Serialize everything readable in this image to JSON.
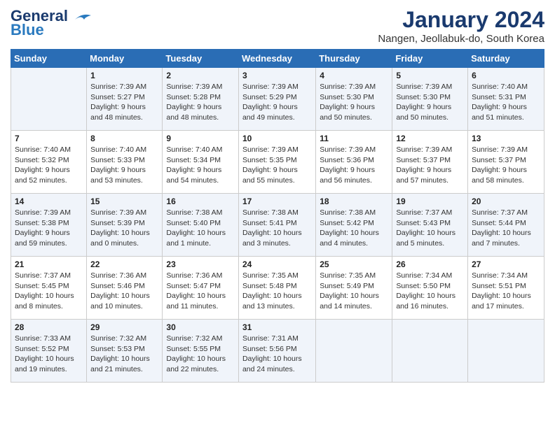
{
  "logo": {
    "line1": "General",
    "line2": "Blue"
  },
  "title": "January 2024",
  "subtitle": "Nangen, Jeollabuk-do, South Korea",
  "days_of_week": [
    "Sunday",
    "Monday",
    "Tuesday",
    "Wednesday",
    "Thursday",
    "Friday",
    "Saturday"
  ],
  "weeks": [
    [
      {
        "day": "",
        "data": ""
      },
      {
        "day": "1",
        "data": "Sunrise: 7:39 AM\nSunset: 5:27 PM\nDaylight: 9 hours\nand 48 minutes."
      },
      {
        "day": "2",
        "data": "Sunrise: 7:39 AM\nSunset: 5:28 PM\nDaylight: 9 hours\nand 48 minutes."
      },
      {
        "day": "3",
        "data": "Sunrise: 7:39 AM\nSunset: 5:29 PM\nDaylight: 9 hours\nand 49 minutes."
      },
      {
        "day": "4",
        "data": "Sunrise: 7:39 AM\nSunset: 5:30 PM\nDaylight: 9 hours\nand 50 minutes."
      },
      {
        "day": "5",
        "data": "Sunrise: 7:39 AM\nSunset: 5:30 PM\nDaylight: 9 hours\nand 50 minutes."
      },
      {
        "day": "6",
        "data": "Sunrise: 7:40 AM\nSunset: 5:31 PM\nDaylight: 9 hours\nand 51 minutes."
      }
    ],
    [
      {
        "day": "7",
        "data": "Sunrise: 7:40 AM\nSunset: 5:32 PM\nDaylight: 9 hours\nand 52 minutes."
      },
      {
        "day": "8",
        "data": "Sunrise: 7:40 AM\nSunset: 5:33 PM\nDaylight: 9 hours\nand 53 minutes."
      },
      {
        "day": "9",
        "data": "Sunrise: 7:40 AM\nSunset: 5:34 PM\nDaylight: 9 hours\nand 54 minutes."
      },
      {
        "day": "10",
        "data": "Sunrise: 7:39 AM\nSunset: 5:35 PM\nDaylight: 9 hours\nand 55 minutes."
      },
      {
        "day": "11",
        "data": "Sunrise: 7:39 AM\nSunset: 5:36 PM\nDaylight: 9 hours\nand 56 minutes."
      },
      {
        "day": "12",
        "data": "Sunrise: 7:39 AM\nSunset: 5:37 PM\nDaylight: 9 hours\nand 57 minutes."
      },
      {
        "day": "13",
        "data": "Sunrise: 7:39 AM\nSunset: 5:37 PM\nDaylight: 9 hours\nand 58 minutes."
      }
    ],
    [
      {
        "day": "14",
        "data": "Sunrise: 7:39 AM\nSunset: 5:38 PM\nDaylight: 9 hours\nand 59 minutes."
      },
      {
        "day": "15",
        "data": "Sunrise: 7:39 AM\nSunset: 5:39 PM\nDaylight: 10 hours\nand 0 minutes."
      },
      {
        "day": "16",
        "data": "Sunrise: 7:38 AM\nSunset: 5:40 PM\nDaylight: 10 hours\nand 1 minute."
      },
      {
        "day": "17",
        "data": "Sunrise: 7:38 AM\nSunset: 5:41 PM\nDaylight: 10 hours\nand 3 minutes."
      },
      {
        "day": "18",
        "data": "Sunrise: 7:38 AM\nSunset: 5:42 PM\nDaylight: 10 hours\nand 4 minutes."
      },
      {
        "day": "19",
        "data": "Sunrise: 7:37 AM\nSunset: 5:43 PM\nDaylight: 10 hours\nand 5 minutes."
      },
      {
        "day": "20",
        "data": "Sunrise: 7:37 AM\nSunset: 5:44 PM\nDaylight: 10 hours\nand 7 minutes."
      }
    ],
    [
      {
        "day": "21",
        "data": "Sunrise: 7:37 AM\nSunset: 5:45 PM\nDaylight: 10 hours\nand 8 minutes."
      },
      {
        "day": "22",
        "data": "Sunrise: 7:36 AM\nSunset: 5:46 PM\nDaylight: 10 hours\nand 10 minutes."
      },
      {
        "day": "23",
        "data": "Sunrise: 7:36 AM\nSunset: 5:47 PM\nDaylight: 10 hours\nand 11 minutes."
      },
      {
        "day": "24",
        "data": "Sunrise: 7:35 AM\nSunset: 5:48 PM\nDaylight: 10 hours\nand 13 minutes."
      },
      {
        "day": "25",
        "data": "Sunrise: 7:35 AM\nSunset: 5:49 PM\nDaylight: 10 hours\nand 14 minutes."
      },
      {
        "day": "26",
        "data": "Sunrise: 7:34 AM\nSunset: 5:50 PM\nDaylight: 10 hours\nand 16 minutes."
      },
      {
        "day": "27",
        "data": "Sunrise: 7:34 AM\nSunset: 5:51 PM\nDaylight: 10 hours\nand 17 minutes."
      }
    ],
    [
      {
        "day": "28",
        "data": "Sunrise: 7:33 AM\nSunset: 5:52 PM\nDaylight: 10 hours\nand 19 minutes."
      },
      {
        "day": "29",
        "data": "Sunrise: 7:32 AM\nSunset: 5:53 PM\nDaylight: 10 hours\nand 21 minutes."
      },
      {
        "day": "30",
        "data": "Sunrise: 7:32 AM\nSunset: 5:55 PM\nDaylight: 10 hours\nand 22 minutes."
      },
      {
        "day": "31",
        "data": "Sunrise: 7:31 AM\nSunset: 5:56 PM\nDaylight: 10 hours\nand 24 minutes."
      },
      {
        "day": "",
        "data": ""
      },
      {
        "day": "",
        "data": ""
      },
      {
        "day": "",
        "data": ""
      }
    ]
  ]
}
